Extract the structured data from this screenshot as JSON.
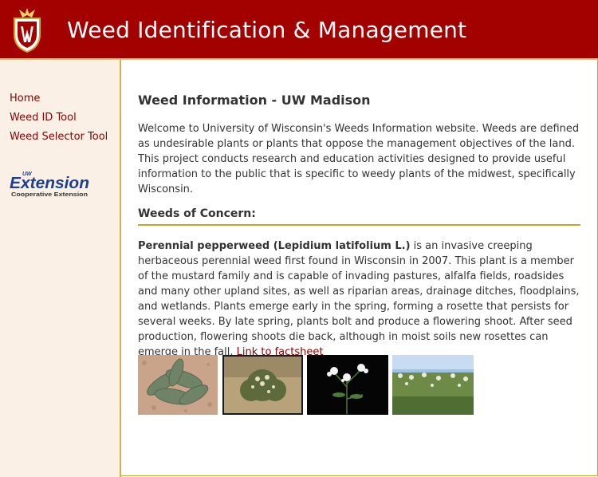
{
  "header": {
    "title": "Weed Identification & Management"
  },
  "sidebar": {
    "items": [
      {
        "label": "Home"
      },
      {
        "label": "Weed ID Tool"
      },
      {
        "label": "Weed Selector Tool"
      }
    ],
    "extension_logo": {
      "top": "UW",
      "main": "Extension",
      "bottom": "Cooperative Extension"
    }
  },
  "main": {
    "title": "Weed Information - UW Madison",
    "intro": "Welcome to University of Wisconsin's Weeds Information website. Weeds are defined as undesirable plants or plants that oppose the management objectives of the land. This project conducts research and education activities designed to provide useful information to the public that is specific to weedy plants of the midwest, specifically Wisconsin.",
    "section_title": "Weeds of Concern:",
    "weed": {
      "name": "Perennial pepperweed (Lepidium latifolium L.)",
      "description": " is an invasive creeping herbaceous perennial weed first found in Wisconsin in 2007. This plant is a member of the mustard family and is capable of invading pastures, alfalfa fields, roadsides and many other upland sites, as well as riparian areas, drainage ditches, floodplains, and wetlands. Plants emerge early in the spring, forming a rosette that persists for several weeks. By late spring, plants bolt and produce a flowering shoot. After seed production, flowering shoots die back, although in moist soils new rosettes can emerge in the fall. ",
      "link_label": "Link to factsheet"
    }
  },
  "colors": {
    "brand": "#a30000",
    "sidebar_bg": "#fbf0e6",
    "gold": "#c9a227",
    "link": "#8b0000"
  }
}
